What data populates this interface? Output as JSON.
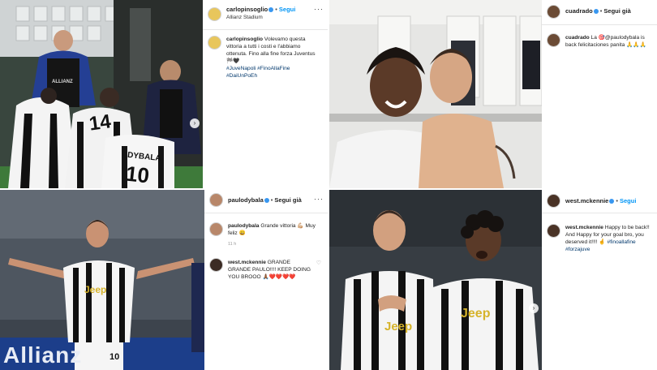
{
  "posts": [
    {
      "username": "carlopinsoglio",
      "follow": "Segui",
      "location": "Allianz Stadium",
      "caption_user": "carlopinsoglio",
      "caption": "Volevamo questa vittoria a tutti i costi e l'abbiamo ottenuta. Fino alla fine forza Juventus 🏁🖤",
      "hashtags": "#JuveNapoli #FinoAllaFine #DaiUnPoEh",
      "photo": {
        "jersey1": "14",
        "jersey2": "DYBALA",
        "jersey3": "10",
        "sponsor": "ALLIANZ"
      }
    },
    {
      "username": "cuadrado",
      "follow": "Segui già",
      "caption_user": "cuadrado",
      "caption": "La 🎯@paulodybala is back felicitaciones panita 🙏🙏🙏"
    },
    {
      "username": "paulodybala",
      "follow": "Segui già",
      "caption_user": "paulodybala",
      "caption": "Grande vittoria 💪🏼 Muy feliz 😀",
      "time": "11 h",
      "reply_user": "west.mckennie",
      "reply": "GRANDE GRANDE PAULO!!!! KEEP DOING YOU BROOO 🙏🏾❤️❤️❤️❤️",
      "photo": {
        "jersey_number": "10",
        "sponsor": "Jeep",
        "banner": "Allianz"
      }
    },
    {
      "username": "west.mckennie",
      "follow": "Segui",
      "caption_user": "west.mckennie",
      "caption": "Happy to be back!! And Happy for your goal bro, you deserved it!!!! 🤞",
      "hashtags": "#finoallafine #forzajuve",
      "photo": {
        "sponsor": "Jeep"
      }
    }
  ],
  "icons": {
    "more": "more-options-icon",
    "verified": "verified-badge-icon",
    "heart": "heart-icon",
    "next": "next-slide-icon"
  },
  "colors": {
    "follow_blue": "#0095f6",
    "juve_black": "#111111"
  }
}
